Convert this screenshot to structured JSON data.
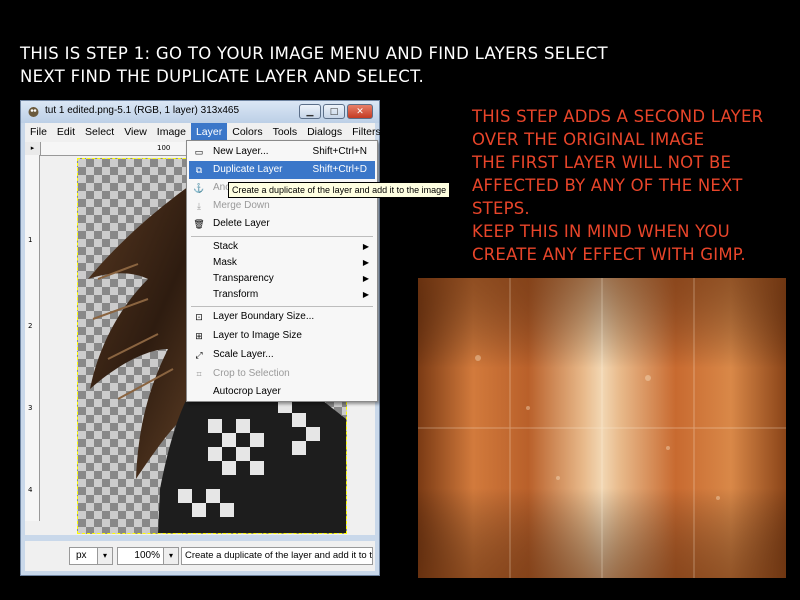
{
  "heading": {
    "line1": "THIS IS STEP 1: GO TO YOUR IMAGE MENU AND FIND LAYERS SELECT",
    "line2": "NEXT FIND THE DUPLICATE LAYER AND SELECT."
  },
  "note": {
    "lines": [
      "THIS STEP ADDS A SECOND LAYER",
      "OVER THE ORIGINAL IMAGE",
      "THE FIRST LAYER WILL NOT BE",
      "AFFECTED BY ANY OF THE NEXT",
      "STEPS.",
      "KEEP THIS IN MIND WHEN YOU",
      "CREATE ANY EFFECT WITH GIMP."
    ],
    "color": "#e8452a"
  },
  "window": {
    "title": "tut 1 edited.png-5.1 (RGB, 1 layer) 313x465",
    "menu": [
      "File",
      "Edit",
      "Select",
      "View",
      "Image",
      "Layer",
      "Colors",
      "Tools",
      "Dialogs",
      "Filters"
    ],
    "active_menu": "Layer",
    "ruler_top_label": "100",
    "ruler_left_labels": [
      "1",
      "2",
      "3",
      "4"
    ]
  },
  "layer_menu": {
    "new_layer": {
      "label": "New Layer...",
      "shortcut": "Shift+Ctrl+N"
    },
    "duplicate_layer": {
      "label": "Duplicate Layer",
      "shortcut": "Shift+Ctrl+D"
    },
    "anchor_layer": {
      "label": "Anc"
    },
    "merge_down": {
      "label": "Merge Down"
    },
    "delete_layer": {
      "label": "Delete Layer"
    },
    "stack": {
      "label": "Stack"
    },
    "mask": {
      "label": "Mask"
    },
    "transparency": {
      "label": "Transparency"
    },
    "transform": {
      "label": "Transform"
    },
    "layer_boundary_size": {
      "label": "Layer Boundary Size..."
    },
    "layer_to_image_size": {
      "label": "Layer to Image Size"
    },
    "scale_layer": {
      "label": "Scale Layer..."
    },
    "crop_to_selection": {
      "label": "Crop to Selection"
    },
    "autocrop_layer": {
      "label": "Autocrop Layer"
    }
  },
  "tooltip": "Create a duplicate of the layer and add it to the image",
  "statusbar": {
    "unit": "px",
    "zoom": "100%",
    "message": "Create a duplicate of the layer and add it to t..."
  }
}
